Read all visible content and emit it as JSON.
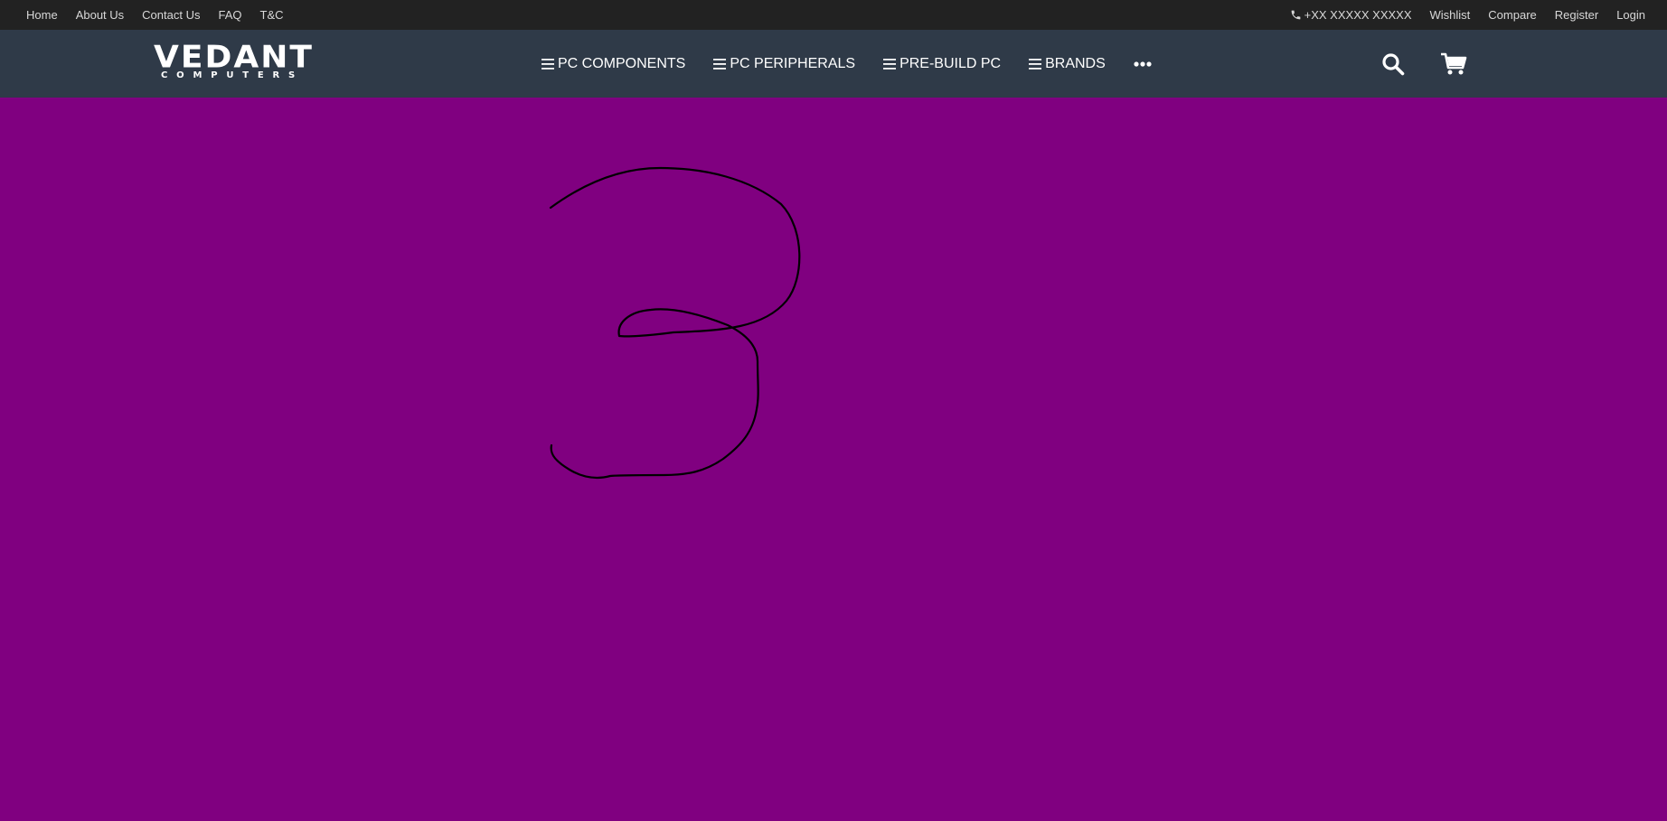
{
  "topbar": {
    "links_left": [
      "Home",
      "About Us",
      "Contact Us",
      "FAQ",
      "T&C"
    ],
    "phone": "+XX XXXXX XXXXX",
    "links_right": [
      "Wishlist",
      "Compare",
      "Register",
      "Login"
    ]
  },
  "logo": {
    "main": "VEDANT",
    "sub": "COMPUTERS"
  },
  "menu": {
    "items": [
      "PC COMPONENTS",
      "PC PERIPHERALS",
      "PRE-BUILD PC",
      "BRANDS"
    ],
    "more_icon": "more-dots-icon"
  },
  "header_icons": [
    "search-icon",
    "cart-icon"
  ],
  "colors": {
    "topbar_bg": "#222222",
    "navbar_bg": "#2f3a48",
    "page_bg": "#800080",
    "drawing_stroke": "#000000"
  },
  "drawing": {
    "shape": "handwritten digit 3"
  }
}
